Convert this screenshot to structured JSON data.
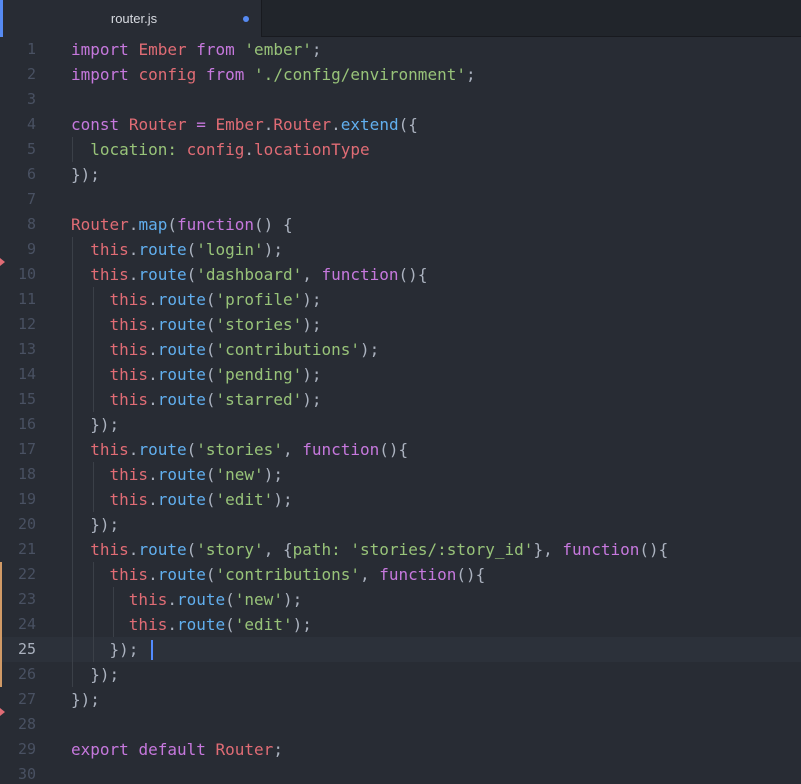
{
  "tab": {
    "title": "router.js",
    "modified": true
  },
  "editor": {
    "current_line": 25,
    "language": "javascript",
    "lines": [
      [
        [
          "kw",
          "import"
        ],
        [
          "pun",
          " "
        ],
        [
          "var",
          "Ember"
        ],
        [
          "pun",
          " "
        ],
        [
          "kw",
          "from"
        ],
        [
          "pun",
          " "
        ],
        [
          "str",
          "'ember'"
        ],
        [
          "pun",
          ";"
        ]
      ],
      [
        [
          "kw",
          "import"
        ],
        [
          "pun",
          " "
        ],
        [
          "var",
          "config"
        ],
        [
          "pun",
          " "
        ],
        [
          "kw",
          "from"
        ],
        [
          "pun",
          " "
        ],
        [
          "str",
          "'./config/environment'"
        ],
        [
          "pun",
          ";"
        ]
      ],
      [],
      [
        [
          "kw",
          "const"
        ],
        [
          "pun",
          " "
        ],
        [
          "var",
          "Router"
        ],
        [
          "pun",
          " "
        ],
        [
          "kw",
          "="
        ],
        [
          "pun",
          " "
        ],
        [
          "var",
          "Ember"
        ],
        [
          "pun",
          "."
        ],
        [
          "var",
          "Router"
        ],
        [
          "pun",
          "."
        ],
        [
          "fn",
          "extend"
        ],
        [
          "pun",
          "({"
        ]
      ],
      [
        [
          "pun",
          "  "
        ],
        [
          "str",
          "location:"
        ],
        [
          "pun",
          " "
        ],
        [
          "var",
          "config"
        ],
        [
          "pun",
          "."
        ],
        [
          "var",
          "locationType"
        ]
      ],
      [
        [
          "pun",
          "});"
        ]
      ],
      [],
      [
        [
          "var",
          "Router"
        ],
        [
          "pun",
          "."
        ],
        [
          "fn",
          "map"
        ],
        [
          "pun",
          "("
        ],
        [
          "kw",
          "function"
        ],
        [
          "pun",
          "() {"
        ]
      ],
      [
        [
          "pun",
          "  "
        ],
        [
          "var",
          "this"
        ],
        [
          "pun",
          "."
        ],
        [
          "fn",
          "route"
        ],
        [
          "pun",
          "("
        ],
        [
          "str",
          "'login'"
        ],
        [
          "pun",
          ");"
        ]
      ],
      [
        [
          "pun",
          "  "
        ],
        [
          "var",
          "this"
        ],
        [
          "pun",
          "."
        ],
        [
          "fn",
          "route"
        ],
        [
          "pun",
          "("
        ],
        [
          "str",
          "'dashboard'"
        ],
        [
          "pun",
          ", "
        ],
        [
          "kw",
          "function"
        ],
        [
          "pun",
          "(){"
        ]
      ],
      [
        [
          "pun",
          "    "
        ],
        [
          "var",
          "this"
        ],
        [
          "pun",
          "."
        ],
        [
          "fn",
          "route"
        ],
        [
          "pun",
          "("
        ],
        [
          "str",
          "'profile'"
        ],
        [
          "pun",
          ");"
        ]
      ],
      [
        [
          "pun",
          "    "
        ],
        [
          "var",
          "this"
        ],
        [
          "pun",
          "."
        ],
        [
          "fn",
          "route"
        ],
        [
          "pun",
          "("
        ],
        [
          "str",
          "'stories'"
        ],
        [
          "pun",
          ");"
        ]
      ],
      [
        [
          "pun",
          "    "
        ],
        [
          "var",
          "this"
        ],
        [
          "pun",
          "."
        ],
        [
          "fn",
          "route"
        ],
        [
          "pun",
          "("
        ],
        [
          "str",
          "'contributions'"
        ],
        [
          "pun",
          ");"
        ]
      ],
      [
        [
          "pun",
          "    "
        ],
        [
          "var",
          "this"
        ],
        [
          "pun",
          "."
        ],
        [
          "fn",
          "route"
        ],
        [
          "pun",
          "("
        ],
        [
          "str",
          "'pending'"
        ],
        [
          "pun",
          ");"
        ]
      ],
      [
        [
          "pun",
          "    "
        ],
        [
          "var",
          "this"
        ],
        [
          "pun",
          "."
        ],
        [
          "fn",
          "route"
        ],
        [
          "pun",
          "("
        ],
        [
          "str",
          "'starred'"
        ],
        [
          "pun",
          ");"
        ]
      ],
      [
        [
          "pun",
          "  });"
        ]
      ],
      [
        [
          "pun",
          "  "
        ],
        [
          "var",
          "this"
        ],
        [
          "pun",
          "."
        ],
        [
          "fn",
          "route"
        ],
        [
          "pun",
          "("
        ],
        [
          "str",
          "'stories'"
        ],
        [
          "pun",
          ", "
        ],
        [
          "kw",
          "function"
        ],
        [
          "pun",
          "(){"
        ]
      ],
      [
        [
          "pun",
          "    "
        ],
        [
          "var",
          "this"
        ],
        [
          "pun",
          "."
        ],
        [
          "fn",
          "route"
        ],
        [
          "pun",
          "("
        ],
        [
          "str",
          "'new'"
        ],
        [
          "pun",
          ");"
        ]
      ],
      [
        [
          "pun",
          "    "
        ],
        [
          "var",
          "this"
        ],
        [
          "pun",
          "."
        ],
        [
          "fn",
          "route"
        ],
        [
          "pun",
          "("
        ],
        [
          "str",
          "'edit'"
        ],
        [
          "pun",
          ");"
        ]
      ],
      [
        [
          "pun",
          "  });"
        ]
      ],
      [
        [
          "pun",
          "  "
        ],
        [
          "var",
          "this"
        ],
        [
          "pun",
          "."
        ],
        [
          "fn",
          "route"
        ],
        [
          "pun",
          "("
        ],
        [
          "str",
          "'story'"
        ],
        [
          "pun",
          ", {"
        ],
        [
          "str",
          "path:"
        ],
        [
          "pun",
          " "
        ],
        [
          "str",
          "'stories/:story_id'"
        ],
        [
          "pun",
          "}, "
        ],
        [
          "kw",
          "function"
        ],
        [
          "pun",
          "(){"
        ]
      ],
      [
        [
          "pun",
          "    "
        ],
        [
          "var",
          "this"
        ],
        [
          "pun",
          "."
        ],
        [
          "fn",
          "route"
        ],
        [
          "pun",
          "("
        ],
        [
          "str",
          "'contributions'"
        ],
        [
          "pun",
          ", "
        ],
        [
          "kw",
          "function"
        ],
        [
          "pun",
          "(){"
        ]
      ],
      [
        [
          "pun",
          "      "
        ],
        [
          "var",
          "this"
        ],
        [
          "pun",
          "."
        ],
        [
          "fn",
          "route"
        ],
        [
          "pun",
          "("
        ],
        [
          "str",
          "'new'"
        ],
        [
          "pun",
          ");"
        ]
      ],
      [
        [
          "pun",
          "      "
        ],
        [
          "var",
          "this"
        ],
        [
          "pun",
          "."
        ],
        [
          "fn",
          "route"
        ],
        [
          "pun",
          "("
        ],
        [
          "str",
          "'edit'"
        ],
        [
          "pun",
          ");"
        ]
      ],
      [
        [
          "pun",
          "    });"
        ]
      ],
      [
        [
          "pun",
          "  });"
        ]
      ],
      [
        [
          "pun",
          "});"
        ]
      ],
      [],
      [
        [
          "kw",
          "export"
        ],
        [
          "pun",
          " "
        ],
        [
          "kw",
          "default"
        ],
        [
          "pun",
          " "
        ],
        [
          "var",
          "Router"
        ],
        [
          "pun",
          ";"
        ]
      ],
      []
    ]
  },
  "git_markers": {
    "deleted_after_lines": [
      9,
      27
    ],
    "modified_lines": [
      22,
      23,
      24,
      25,
      26
    ]
  },
  "colors": {
    "background": "#282c34",
    "keyword": "#c678dd",
    "variable": "#e06c75",
    "string": "#98c379",
    "function": "#61afef",
    "punctuation": "#abb2bf",
    "accent": "#568af2"
  }
}
